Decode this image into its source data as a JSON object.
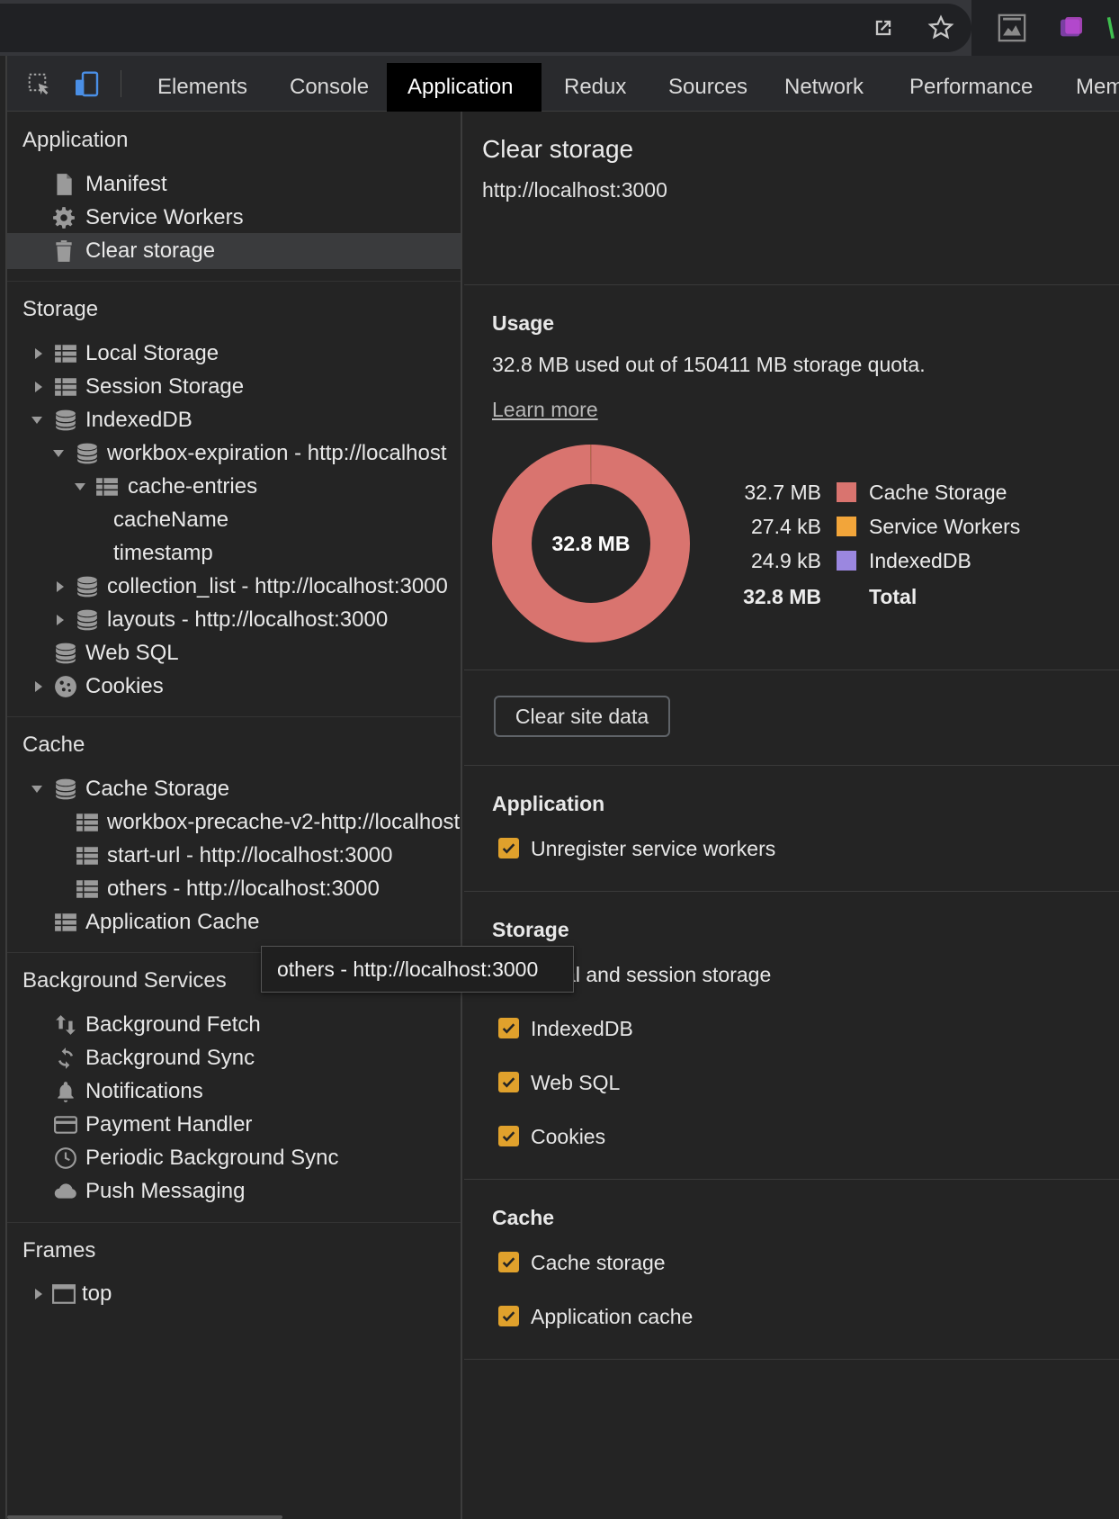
{
  "browser_icons": [
    "open-in-new-icon",
    "star-icon",
    "extension-icon",
    "extension-purple-icon"
  ],
  "tabs": [
    {
      "label": "Elements"
    },
    {
      "label": "Console"
    },
    {
      "label": "Application"
    },
    {
      "label": "Redux"
    },
    {
      "label": "Sources"
    },
    {
      "label": "Network"
    },
    {
      "label": "Performance"
    },
    {
      "label": "Mem"
    }
  ],
  "active_tab": "Application",
  "sidebar": {
    "application": {
      "title": "Application",
      "items": [
        {
          "label": "Manifest",
          "icon": "document-icon"
        },
        {
          "label": "Service Workers",
          "icon": "gear-icon"
        },
        {
          "label": "Clear storage",
          "icon": "trash-icon"
        }
      ]
    },
    "storage": {
      "title": "Storage",
      "items": [
        {
          "label": "Local Storage"
        },
        {
          "label": "Session Storage"
        },
        {
          "label": "IndexedDB"
        },
        {
          "label": "workbox-expiration - http://localhost"
        },
        {
          "label": "cache-entries"
        },
        {
          "label": "cacheName"
        },
        {
          "label": "timestamp"
        },
        {
          "label": "collection_list - http://localhost:3000"
        },
        {
          "label": "layouts - http://localhost:3000"
        },
        {
          "label": "Web SQL"
        },
        {
          "label": "Cookies"
        }
      ]
    },
    "cache": {
      "title": "Cache",
      "items": [
        {
          "label": "Cache Storage"
        },
        {
          "label": "workbox-precache-v2-http://localhost"
        },
        {
          "label": "start-url - http://localhost:3000"
        },
        {
          "label": "others - http://localhost:3000"
        },
        {
          "label": "Application Cache"
        }
      ]
    },
    "background": {
      "title": "Background Services",
      "items": [
        {
          "label": "Background Fetch"
        },
        {
          "label": "Background Sync"
        },
        {
          "label": "Notifications"
        },
        {
          "label": "Payment Handler"
        },
        {
          "label": "Periodic Background Sync"
        },
        {
          "label": "Push Messaging"
        }
      ]
    },
    "frames": {
      "title": "Frames",
      "items": [
        {
          "label": "top"
        }
      ]
    }
  },
  "main": {
    "title": "Clear storage",
    "origin": "http://localhost:3000",
    "usage": {
      "heading": "Usage",
      "text": "32.8 MB used out of 150411 MB storage quota.",
      "learn_more": "Learn more",
      "donut_center": "32.8 MB",
      "legend": [
        {
          "value": "32.7 MB",
          "name": "Cache Storage",
          "color": "#d9746f",
          "fraction": 0.9984
        },
        {
          "value": "27.4 kB",
          "name": "Service Workers",
          "color": "#f2a53a",
          "fraction": 0.0008
        },
        {
          "value": "24.9 kB",
          "name": "IndexedDB",
          "color": "#9b87e0",
          "fraction": 0.0008
        }
      ],
      "total_value": "32.8 MB",
      "total_label": "Total"
    },
    "clear_button": "Clear site data",
    "application_heading": "Application",
    "application_options": [
      "Unregister service workers"
    ],
    "storage_heading": "Storage",
    "storage_options": [
      "Local and session storage",
      "IndexedDB",
      "Web SQL",
      "Cookies"
    ],
    "cache_heading": "Cache",
    "cache_options": [
      "Cache storage",
      "Application cache"
    ]
  },
  "tooltip": "others - http://localhost:3000"
}
